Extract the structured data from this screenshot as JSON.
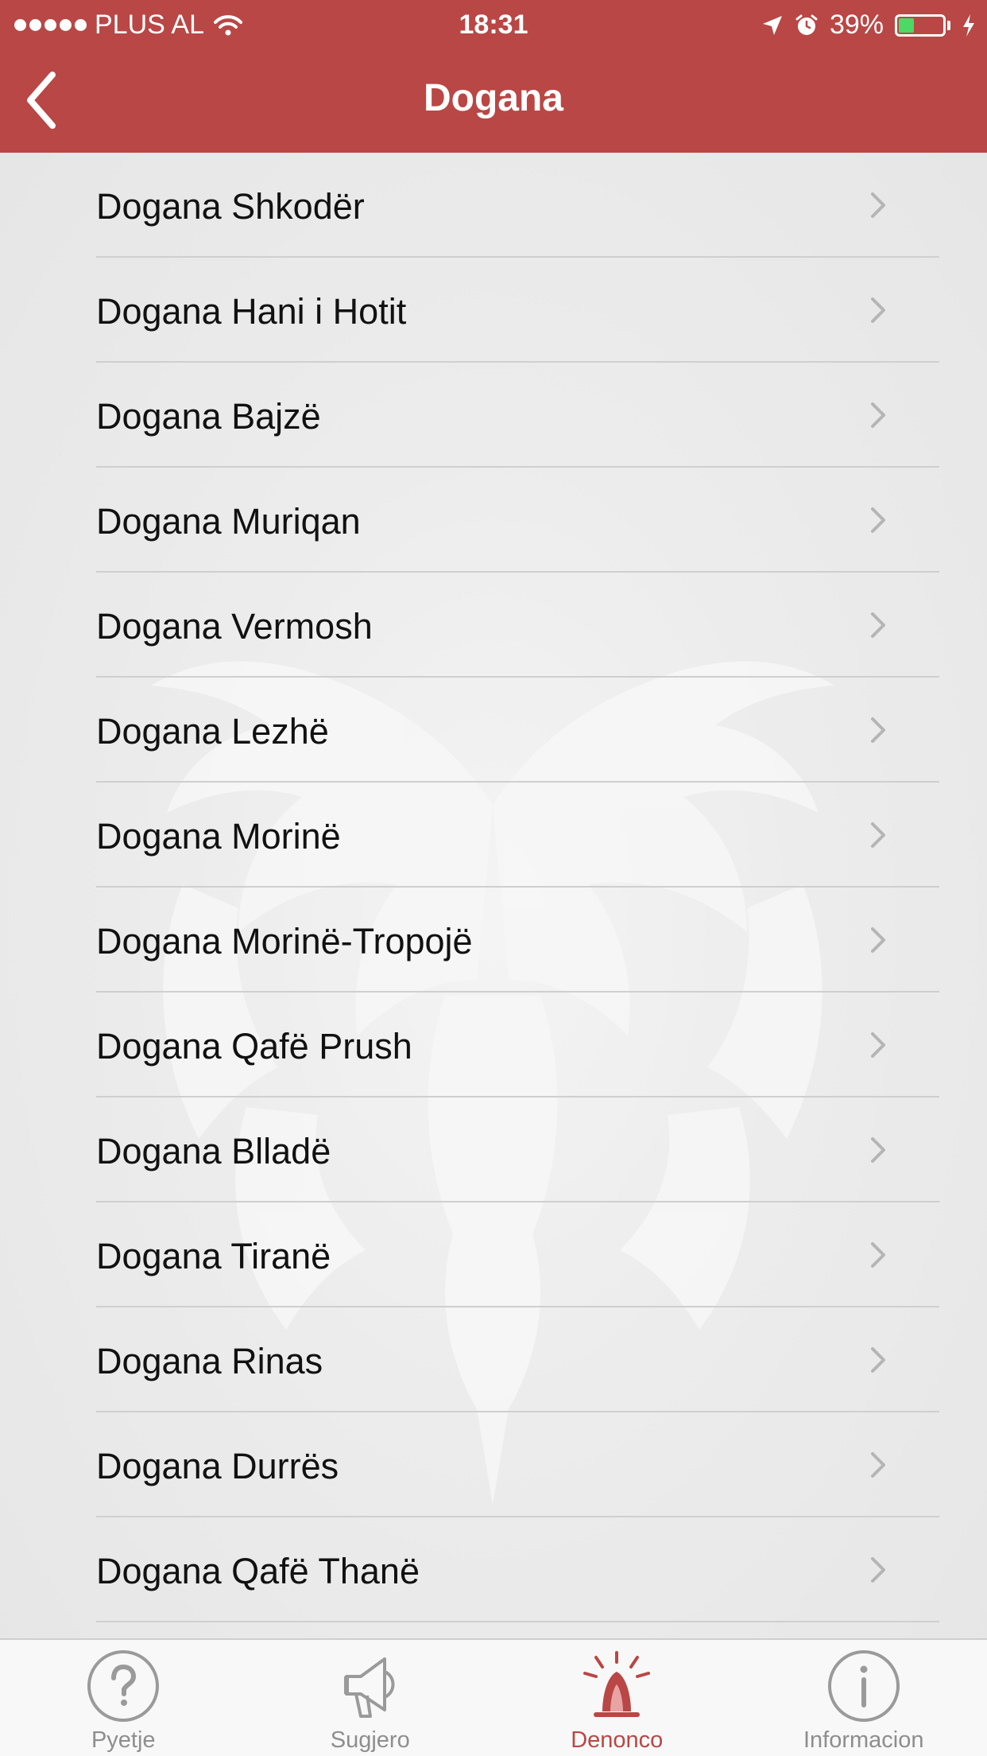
{
  "status_bar": {
    "carrier": "PLUS AL",
    "time": "18:31",
    "battery_percent": "39%",
    "battery_level": 0.39,
    "icons": [
      "signal-dots-icon",
      "wifi-icon",
      "location-arrow-icon",
      "alarm-icon",
      "battery-icon",
      "charging-bolt-icon"
    ]
  },
  "navbar": {
    "title": "Dogana",
    "back_icon": "chevron-left-icon"
  },
  "list": {
    "items": [
      {
        "label": "Dogana Shkodër"
      },
      {
        "label": "Dogana Hani i Hotit"
      },
      {
        "label": "Dogana Bajzë"
      },
      {
        "label": "Dogana Muriqan"
      },
      {
        "label": "Dogana Vermosh"
      },
      {
        "label": "Dogana Lezhë"
      },
      {
        "label": "Dogana Morinë"
      },
      {
        "label": "Dogana Morinë-Tropojë"
      },
      {
        "label": "Dogana Qafë Prush"
      },
      {
        "label": "Dogana Blladë"
      },
      {
        "label": "Dogana Tiranë"
      },
      {
        "label": "Dogana Rinas"
      },
      {
        "label": "Dogana Durrës"
      },
      {
        "label": "Dogana Qafë Thanë"
      }
    ],
    "chevron_icon": "chevron-right-icon",
    "background_icon": "double-headed-eagle-icon"
  },
  "tabbar": {
    "tabs": [
      {
        "label": "Pyetje",
        "icon": "question-circle-icon",
        "active": false
      },
      {
        "label": "Sugjero",
        "icon": "megaphone-icon",
        "active": false
      },
      {
        "label": "Denonco",
        "icon": "alert-bell-icon",
        "active": true
      },
      {
        "label": "Informacion",
        "icon": "info-circle-icon",
        "active": false
      }
    ]
  },
  "colors": {
    "brand": "#b94745",
    "background": "#e8e8e8",
    "battery": "#4cd964",
    "inactive_tab": "#8e8e8e"
  }
}
